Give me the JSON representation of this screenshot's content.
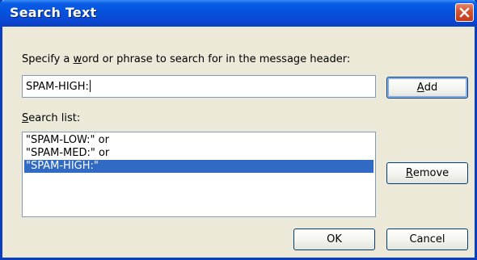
{
  "window": {
    "title": "Search Text"
  },
  "prompt": {
    "before": "Specify a ",
    "accel": "w",
    "after": "ord or phrase to search for in the message header:"
  },
  "search_input": {
    "value": "SPAM-HIGH:"
  },
  "search_list": {
    "label_accel": "S",
    "label_rest": "earch list:",
    "items": [
      "\"SPAM-LOW:\" or",
      "\"SPAM-MED:\" or",
      "\"SPAM-HIGH:\""
    ],
    "selected_index": 2
  },
  "buttons": {
    "add": {
      "accel": "A",
      "rest": "dd"
    },
    "remove": {
      "accel": "R",
      "rest": "emove"
    },
    "ok": "OK",
    "cancel": "Cancel"
  },
  "icons": {
    "close": "close-icon"
  },
  "colors": {
    "titlebar": "#0453de",
    "selection": "#316ac5",
    "close_button": "#d5502f",
    "dialog_background": "#ece9d8"
  }
}
